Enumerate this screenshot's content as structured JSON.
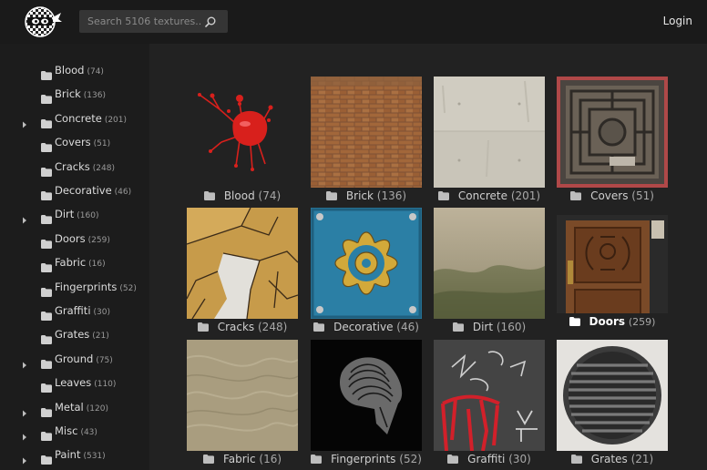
{
  "header": {
    "search_placeholder": "Search 5106 textures...",
    "login_label": "Login"
  },
  "sidebar": {
    "items": [
      {
        "name": "Blood",
        "count": "(74)",
        "expandable": false
      },
      {
        "name": "Brick",
        "count": "(136)",
        "expandable": false
      },
      {
        "name": "Concrete",
        "count": "(201)",
        "expandable": true
      },
      {
        "name": "Covers",
        "count": "(51)",
        "expandable": false
      },
      {
        "name": "Cracks",
        "count": "(248)",
        "expandable": false
      },
      {
        "name": "Decorative",
        "count": "(46)",
        "expandable": false
      },
      {
        "name": "Dirt",
        "count": "(160)",
        "expandable": true
      },
      {
        "name": "Doors",
        "count": "(259)",
        "expandable": false
      },
      {
        "name": "Fabric",
        "count": "(16)",
        "expandable": false
      },
      {
        "name": "Fingerprints",
        "count": "(52)",
        "expandable": false
      },
      {
        "name": "Graffiti",
        "count": "(30)",
        "expandable": false
      },
      {
        "name": "Grates",
        "count": "(21)",
        "expandable": false
      },
      {
        "name": "Ground",
        "count": "(75)",
        "expandable": true
      },
      {
        "name": "Leaves",
        "count": "(110)",
        "expandable": false
      },
      {
        "name": "Metal",
        "count": "(120)",
        "expandable": true
      },
      {
        "name": "Misc",
        "count": "(43)",
        "expandable": true
      },
      {
        "name": "Paint",
        "count": "(531)",
        "expandable": true
      }
    ]
  },
  "grid": {
    "tiles": [
      {
        "name": "Blood",
        "count": "(74)"
      },
      {
        "name": "Brick",
        "count": "(136)"
      },
      {
        "name": "Concrete",
        "count": "(201)"
      },
      {
        "name": "Covers",
        "count": "(51)"
      },
      {
        "name": "Cracks",
        "count": "(248)"
      },
      {
        "name": "Decorative",
        "count": "(46)"
      },
      {
        "name": "Dirt",
        "count": "(160)"
      },
      {
        "name": "Doors",
        "count": "(259)"
      },
      {
        "name": "Fabric",
        "count": "(16)"
      },
      {
        "name": "Fingerprints",
        "count": "(52)"
      },
      {
        "name": "Graffiti",
        "count": "(30)"
      },
      {
        "name": "Grates",
        "count": "(21)"
      }
    ]
  },
  "colors": {
    "background": "#222222",
    "topbar": "#1a1a1a",
    "sidebar": "#1c1c1c",
    "blood": "#d8201c"
  }
}
